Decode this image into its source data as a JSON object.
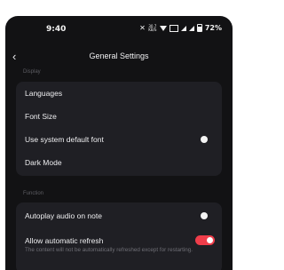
{
  "status_bar": {
    "time": "9:40",
    "speed_value": "30.7",
    "speed_unit": "KB/S",
    "battery": "72%",
    "icons": [
      "mute-icon",
      "network-speed-icon",
      "wifi-icon",
      "sim-icon",
      "signal-icon",
      "signal-icon",
      "battery-icon"
    ]
  },
  "header": {
    "title": "General Settings",
    "back_icon": "chevron-left-icon"
  },
  "display_section": {
    "label": "Display",
    "items": [
      {
        "label": "Languages"
      },
      {
        "label": "Font Size"
      },
      {
        "label": "Use system default font",
        "toggle": false
      },
      {
        "label": "Dark Mode"
      }
    ]
  },
  "function_section": {
    "label": "Function",
    "items": [
      {
        "label": "Autoplay audio on note",
        "toggle": false
      },
      {
        "label": "Allow automatic refresh",
        "toggle": true,
        "description": "The content will not be automatically refreshed except for restarting."
      }
    ]
  },
  "colors": {
    "background": "#121214",
    "card": "#1f1f24",
    "accent": "#ef3d4a",
    "section_label": "#5d5d63"
  }
}
